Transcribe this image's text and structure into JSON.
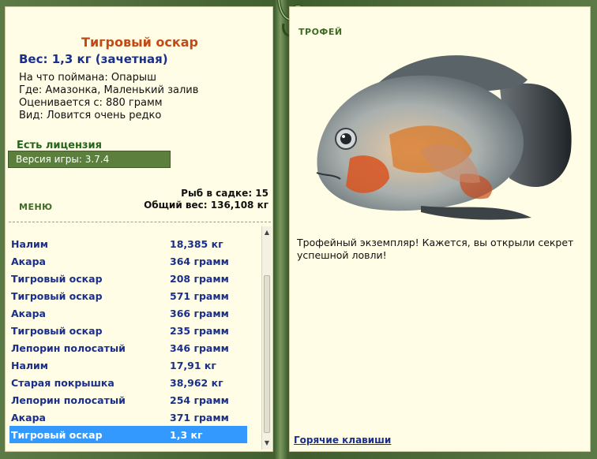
{
  "catch": {
    "title": "Тигровый оскар",
    "weight": "Вес: 1,3 кг (зачетная)",
    "bait": "На что поймана: Опарыш",
    "location": "Где: Амазонка, Маленький залив",
    "value": "Оценивается с: 880 грамм",
    "rarity": "Вид: Ловится очень редко"
  },
  "license": "Есть лицензия",
  "version": "Версия игры: 3.7.4",
  "menu": "МЕНЮ",
  "keepnet": {
    "count": "Рыб в садке: 15",
    "total": "Общий вес: 136,108 кг"
  },
  "fish_list": [
    {
      "name": "Налим",
      "weight": "18,385 кг"
    },
    {
      "name": "Акара",
      "weight": "364 грамм"
    },
    {
      "name": "Тигровый оскар",
      "weight": "208 грамм"
    },
    {
      "name": "Тигровый оскар",
      "weight": "571 грамм"
    },
    {
      "name": "Акара",
      "weight": "366 грамм"
    },
    {
      "name": "Тигровый оскар",
      "weight": "235 грамм"
    },
    {
      "name": "Лепорин полосатый",
      "weight": "346 грамм"
    },
    {
      "name": "Налим",
      "weight": "17,91 кг"
    },
    {
      "name": "Старая покрышка",
      "weight": "38,962 кг"
    },
    {
      "name": "Лепорин полосатый",
      "weight": "254 грамм"
    },
    {
      "name": "Акара",
      "weight": "371 грамм"
    },
    {
      "name": "Тигровый оскар",
      "weight": "1,3 кг",
      "selected": true
    }
  ],
  "trophy": {
    "label": "ТРОФЕЙ",
    "text": "Трофейный экземпляр! Кажется, вы открыли секрет успешной ловли!",
    "hotkeys": "Горячие клавиши"
  },
  "colors": {
    "frame": "#4f6e3a",
    "panel": "#fffde5",
    "title": "#c24a14",
    "list_text": "#1a2f8c",
    "selection": "#3399ff",
    "version_bar": "#5d7f3e"
  }
}
